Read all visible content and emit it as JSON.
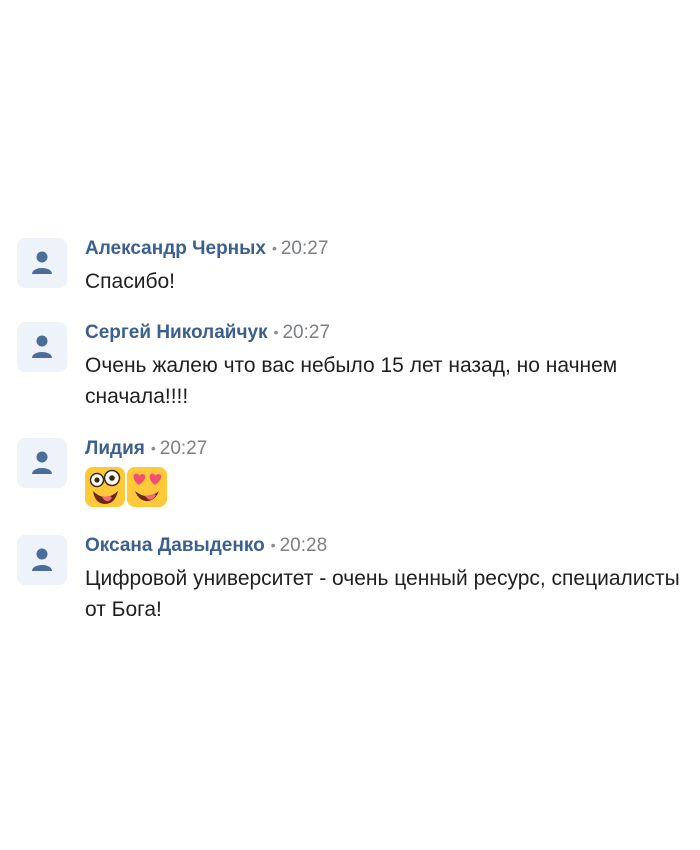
{
  "comments": [
    {
      "author": "Александр Черных",
      "separator": "•",
      "time": "20:27",
      "text": "Спасибо!",
      "avatar_icon": "user-silhouette-icon"
    },
    {
      "author": "Сергей Николайчук",
      "separator": "•",
      "time": "20:27",
      "text": "Очень жалею что вас небыло 15 лет назад, но начнем сначала!!!!",
      "avatar_icon": "user-silhouette-icon"
    },
    {
      "author": "Лидия",
      "separator": "•",
      "time": "20:27",
      "emojis": [
        "crazy-face-emoji-icon",
        "heart-eyes-emoji-icon"
      ],
      "avatar_icon": "user-silhouette-icon"
    },
    {
      "author": "Оксана Давыденко",
      "separator": "•",
      "time": "20:28",
      "text": "Цифровой университет - очень ценный ресурс, специалисты от Бога!",
      "avatar_icon": "user-silhouette-icon"
    }
  ],
  "colors": {
    "author": "#3b5f8e",
    "avatar_bg": "#eef3f9",
    "avatar_icon": "#4a6d9a",
    "text": "#1f1f1f",
    "meta": "#7c7f83",
    "emoji_bg": "#ffc93a"
  }
}
